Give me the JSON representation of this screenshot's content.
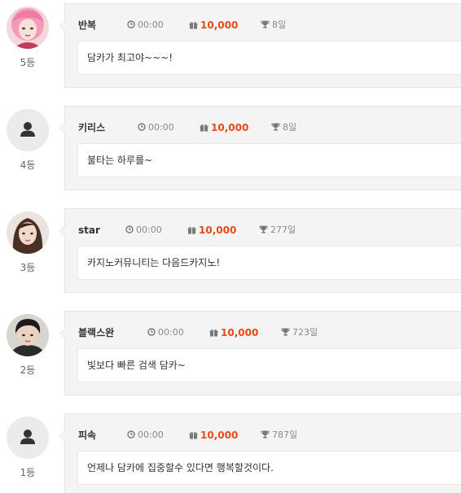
{
  "entries": [
    {
      "rank_label": "5등",
      "avatar": "photo-pink-hair",
      "name": "반복",
      "time": "00:00",
      "points": "10,000",
      "days": "8일",
      "message": "담카가 최고야~~~!"
    },
    {
      "rank_label": "4등",
      "avatar": "default-user-icon",
      "name": "키리스",
      "time": "00:00",
      "points": "10,000",
      "days": "8일",
      "message": "불타는 하루를~"
    },
    {
      "rank_label": "3등",
      "avatar": "photo-long-brown-hair",
      "name": "star",
      "time": "00:00",
      "points": "10,000",
      "days": "277일",
      "message": "카지노커뮤니티는 다음드카지노!"
    },
    {
      "rank_label": "2등",
      "avatar": "photo-dark-hair",
      "name": "블랙스완",
      "time": "00:00",
      "points": "10,000",
      "days": "723일",
      "message": "빛보다 빠른 검색 담카~"
    },
    {
      "rank_label": "1등",
      "avatar": "default-user-icon",
      "name": "피속",
      "time": "00:00",
      "points": "10,000",
      "days": "787일",
      "message": "언제나 담카에 집중할수 있다면 행복할것이다."
    }
  ],
  "colors": {
    "points": "#e64a19",
    "card_bg": "#f4f4f4",
    "meta_text": "#888888"
  }
}
